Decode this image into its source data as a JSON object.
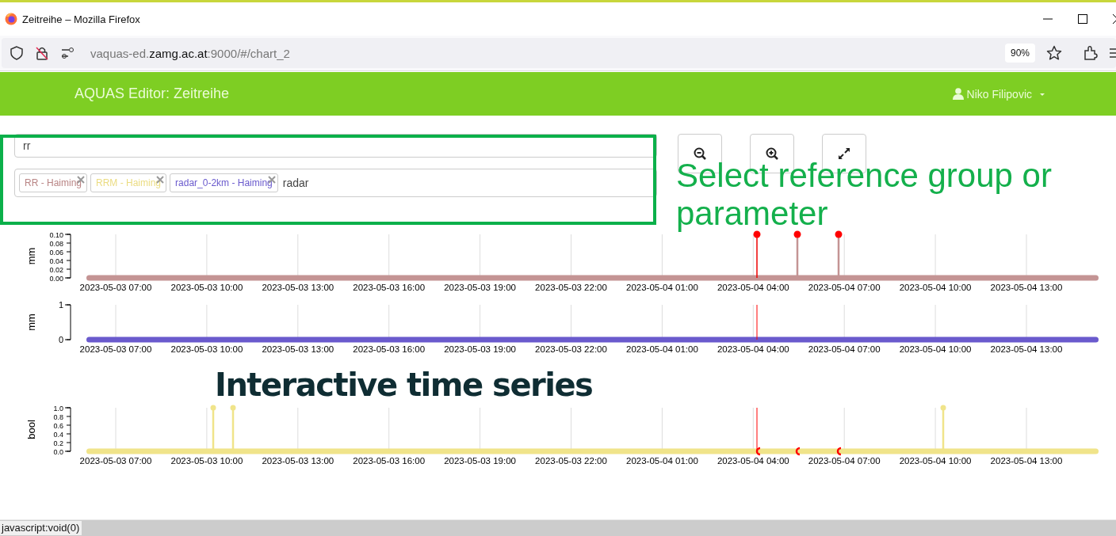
{
  "window": {
    "title": "Zeitreihe – Mozilla Firefox"
  },
  "browser": {
    "url_prefix": "vaquas-ed.",
    "url_domain": "zamg.ac.at",
    "url_rest": ":9000/#/chart_2",
    "zoom": "90%"
  },
  "navbar": {
    "title": "AQUAS Editor: Zeitreihe",
    "user": "Niko Filipovic"
  },
  "filter": {
    "value": "rr"
  },
  "selection": {
    "tags": [
      {
        "label": "RR - Haiming",
        "color": "#b98585"
      },
      {
        "label": "RRM - Haiming",
        "color": "#ebdc82"
      },
      {
        "label": "radar_0-2km - Haiming",
        "color": "#6a5acd"
      }
    ],
    "value": "radar"
  },
  "toolbar": [
    {
      "kind": "zoom-out"
    },
    {
      "kind": "zoom-in"
    },
    {
      "kind": "expand"
    }
  ],
  "annotations": [
    {
      "kind": "selection-note",
      "text": "Select reference group or parameter"
    },
    {
      "kind": "chart-note",
      "text": "Interactive time series"
    }
  ],
  "charts": [
    {
      "ylabel": "mm",
      "color": "#c49494",
      "yticks": [
        "0.10",
        "0.08",
        "0.06",
        "0.04",
        "0.02",
        "0.00"
      ],
      "xticks": [
        "2023-05-03 07:00",
        "2023-05-03 10:00",
        "2023-05-03 13:00",
        "2023-05-03 16:00",
        "2023-05-03 19:00",
        "2023-05-03 22:00",
        "2023-05-04 01:00",
        "2023-05-04 04:00",
        "2023-05-04 07:00",
        "2023-05-04 10:00",
        "2023-05-04 13:00"
      ]
    },
    {
      "ylabel": "mm",
      "color": "#6a5acd",
      "yticks": [
        "1",
        "0"
      ],
      "xticks": [
        "2023-05-03 07:00",
        "2023-05-03 10:00",
        "2023-05-03 13:00",
        "2023-05-03 16:00",
        "2023-05-03 19:00",
        "2023-05-03 22:00",
        "2023-05-04 01:00",
        "2023-05-04 04:00",
        "2023-05-04 07:00",
        "2023-05-04 10:00",
        "2023-05-04 13:00"
      ]
    },
    {
      "ylabel": "bool",
      "color": "#f0e48a",
      "yticks": [
        "1.0",
        "0.8",
        "0.6",
        "0.4",
        "0.2",
        "0.0"
      ],
      "xticks": [
        "2023-05-03 07:00",
        "2023-05-03 10:00",
        "2023-05-03 13:00",
        "2023-05-03 16:00",
        "2023-05-03 19:00",
        "2023-05-03 22:00",
        "2023-05-04 01:00",
        "2023-05-04 04:00",
        "2023-05-04 07:00",
        "2023-05-04 10:00",
        "2023-05-04 13:00"
      ]
    }
  ],
  "status_bar": {
    "text": "javascript:void(0)"
  }
}
